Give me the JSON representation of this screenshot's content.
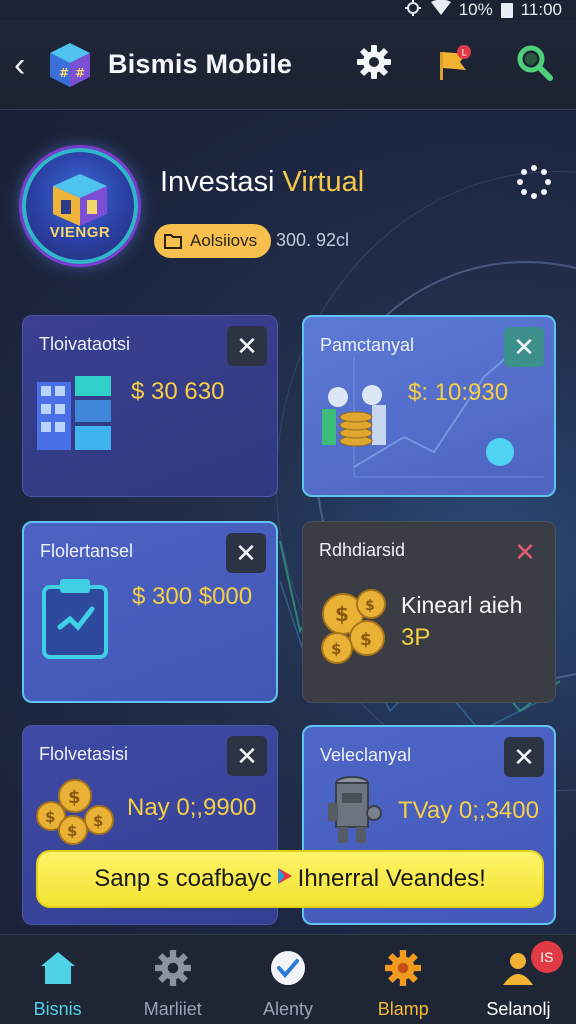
{
  "status_bar": {
    "battery": "10%",
    "time": "11:00",
    "icons": [
      "brightness-icon",
      "wifi-icon",
      "battery-icon"
    ]
  },
  "app_bar": {
    "back_icon": "chevron-left-icon",
    "logo": "cube-logo-icon",
    "title": "Bismis Mobile",
    "actions": [
      "gear-icon",
      "flag-notification-icon",
      "search-icon"
    ]
  },
  "profile": {
    "avatar_label": "VIENGR",
    "title_prefix": "Investasi",
    "title_highlight": "Virtual",
    "badge_label": "Aolsiiovs",
    "value": "300. 92cl",
    "more_icon": "dotted-circle-icon"
  },
  "cards": [
    {
      "label": "Tloivataotsi",
      "value": "$ 30 630",
      "icon": "building-bars-icon"
    },
    {
      "label": "Pamctanyal",
      "value": "$: 10:930",
      "icon": "coins-chart-icon"
    },
    {
      "label": "Flolertansel",
      "value": "$ 300 $000",
      "icon": "clipboard-check-icon"
    },
    {
      "label": "Rdhdiarsid",
      "title": "Kinearl aieh",
      "value": "3P",
      "icon": "gold-coins-icon"
    },
    {
      "label": "Flolvetasisi",
      "value": "Nay 0;,9900",
      "icon": "gold-coins-icon"
    },
    {
      "label": "Veleclanyal",
      "value": "TVay 0;,3400",
      "icon": "robot-icon"
    }
  ],
  "promo": {
    "text_left": "Sanp s coafbayc",
    "text_right": "Ihnerral Veandes!",
    "icon": "play-icon"
  },
  "bottom_nav": [
    {
      "label": "Bisnis",
      "icon": "home-icon",
      "state": "active"
    },
    {
      "label": "Marliiet",
      "icon": "gear-icon",
      "state": "inactive"
    },
    {
      "label": "Alenty",
      "icon": "check-circle-icon",
      "state": "inactive"
    },
    {
      "label": "Blamp",
      "icon": "gear-orange-icon",
      "state": "highlight"
    },
    {
      "label": "Selanolj",
      "icon": "person-icon",
      "state": "inactive",
      "badge": "IS"
    }
  ],
  "colors": {
    "accent_cyan": "#4fd1e6",
    "accent_gold": "#f6cf45",
    "promo_yellow": "#f2e230",
    "badge_red": "#e23a44"
  }
}
